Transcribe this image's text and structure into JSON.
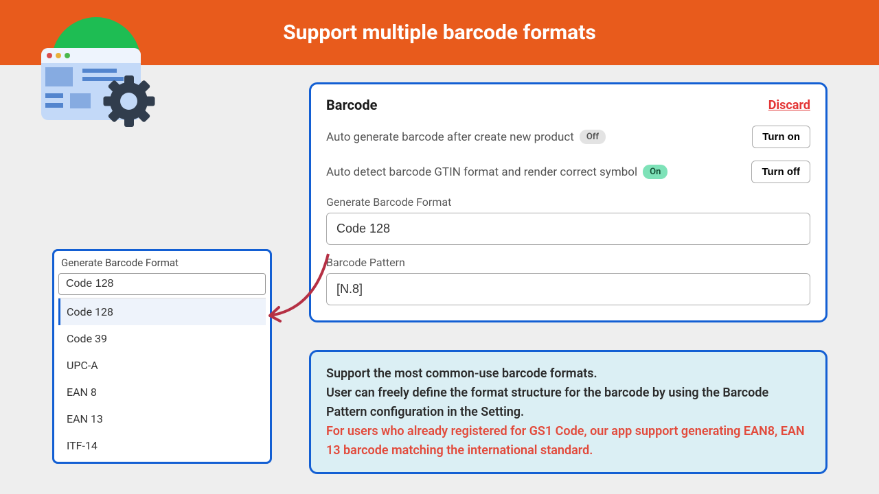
{
  "header": {
    "title": "Support multiple barcode formats"
  },
  "card": {
    "title": "Barcode",
    "discard": "Discard",
    "row1": {
      "label": "Auto generate barcode after create new product",
      "badge": "Off",
      "button": "Turn on"
    },
    "row2": {
      "label": "Auto detect barcode GTIN format and render correct symbol",
      "badge": "On",
      "button": "Turn off"
    },
    "format": {
      "label": "Generate Barcode Format",
      "value": "Code 128"
    },
    "pattern": {
      "label": "Barcode Pattern",
      "value": "[N.8]"
    }
  },
  "popover": {
    "title": "Generate Barcode Format",
    "input": "Code 128",
    "options": [
      "Code 128",
      "Code 39",
      "UPC-A",
      "EAN 8",
      "EAN 13",
      "ITF-14"
    ]
  },
  "callout": {
    "line1": "Support the most common-use barcode formats.",
    "line2": "User can freely define the format structure for the barcode by using the Barcode Pattern configuration in the Setting.",
    "line3": "For users who already registered for GS1 Code, our app support generating EAN8, EAN 13 barcode matching the international standard."
  }
}
